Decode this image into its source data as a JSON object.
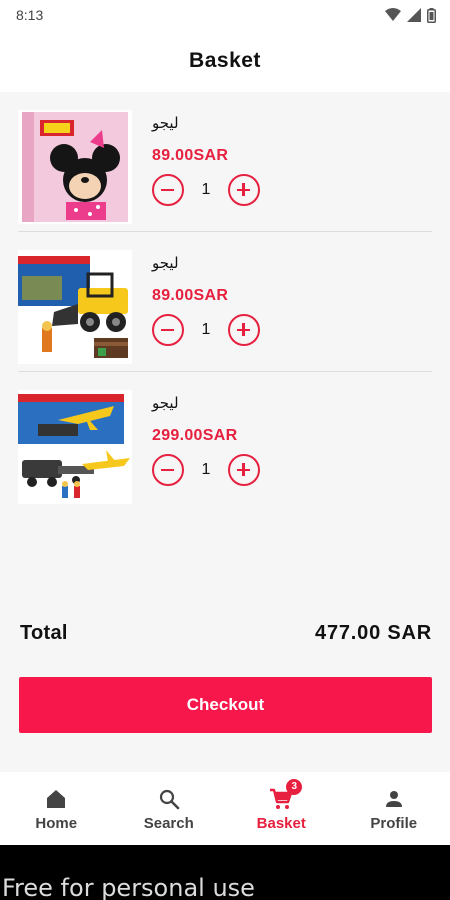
{
  "status_bar": {
    "time": "8:13",
    "icons": [
      "wifi-icon",
      "signal-icon",
      "battery-icon"
    ]
  },
  "header": {
    "title": "Basket"
  },
  "items": [
    {
      "name": "ليجو",
      "price": "89.00SAR",
      "quantity": "1",
      "image": "lego-duplo-minnie-box"
    },
    {
      "name": "ليجو",
      "price": "89.00SAR",
      "quantity": "1",
      "image": "lego-city-construction-loader"
    },
    {
      "name": "ليجو",
      "price": "299.00SAR",
      "quantity": "1",
      "image": "lego-city-jet-transporter"
    }
  ],
  "summary": {
    "total_label": "Total",
    "total_value": "477.00 SAR"
  },
  "checkout": {
    "label": "Checkout"
  },
  "nav": {
    "items": [
      {
        "label": "Home",
        "icon": "home-icon",
        "active": false
      },
      {
        "label": "Search",
        "icon": "search-icon",
        "active": false
      },
      {
        "label": "Basket",
        "icon": "cart-icon",
        "active": true,
        "badge": "3"
      },
      {
        "label": "Profile",
        "icon": "person-icon",
        "active": false
      }
    ]
  },
  "watermark": "Free for personal use",
  "colors": {
    "accent": "#e6203e",
    "checkout": "#f7174a",
    "background": "#f6f6f6"
  }
}
